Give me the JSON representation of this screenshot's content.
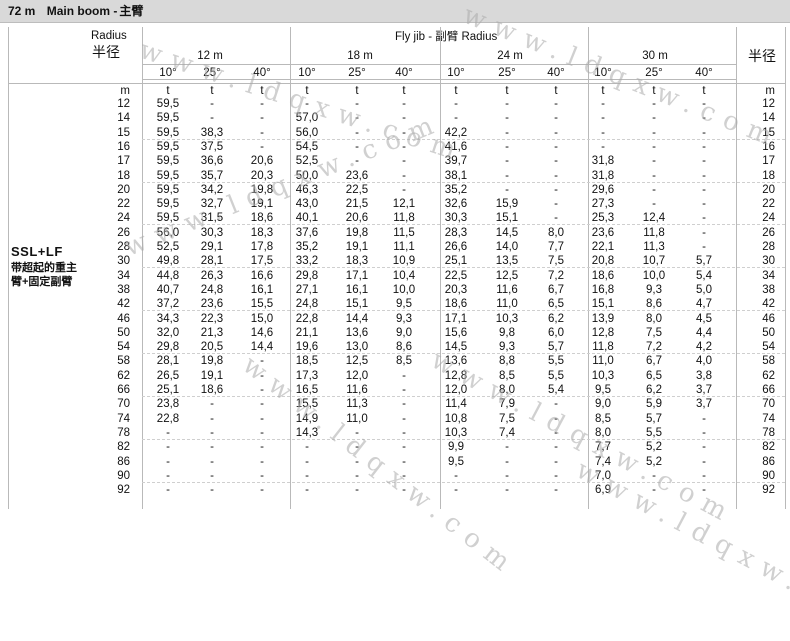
{
  "header": {
    "boom": "72 m",
    "label_en": "Main boom -",
    "label_cn": "主臂"
  },
  "labels": {
    "radius_en": "Radius",
    "radius_cn": "半径",
    "radius_cn_right": "半径",
    "fly_jib": "Fly jib -  副臂 Radius",
    "config_main": "SSL+LF",
    "config_sub": [
      "带超起的重主",
      "臂+固定副臂"
    ]
  },
  "jibs": [
    "12 m",
    "18 m",
    "24 m",
    "30 m"
  ],
  "angles": [
    "10°",
    "25°",
    "40°"
  ],
  "unit_m": "m",
  "unit_t": "t",
  "watermark": "www.ldqxw.com",
  "radii": [
    "12",
    "14",
    "15",
    "16",
    "17",
    "18",
    "20",
    "22",
    "24",
    "26",
    "28",
    "30",
    "34",
    "38",
    "42",
    "46",
    "50",
    "54",
    "58",
    "62",
    "66",
    "70",
    "74",
    "78",
    "82",
    "86",
    "90",
    "92"
  ],
  "rows": [
    [
      "59,5",
      "-",
      "-",
      "-",
      "-",
      "-",
      "-",
      "-",
      "-",
      "-",
      "-",
      "-"
    ],
    [
      "59,5",
      "-",
      "-",
      "57,0",
      "-",
      "-",
      "-",
      "-",
      "-",
      "-",
      "-",
      "-"
    ],
    [
      "59,5",
      "38,3",
      "-",
      "56,0",
      "-",
      "-",
      "42,2",
      "-",
      "-",
      "-",
      "-",
      "-"
    ],
    [
      "59,5",
      "37,5",
      "-",
      "54,5",
      "-",
      "-",
      "41,6",
      "-",
      "-",
      "-",
      "-",
      "-"
    ],
    [
      "59,5",
      "36,6",
      "20,6",
      "52,5",
      "-",
      "-",
      "39,7",
      "-",
      "-",
      "31,8",
      "-",
      "-"
    ],
    [
      "59,5",
      "35,7",
      "20,3",
      "50,0",
      "23,6",
      "-",
      "38,1",
      "-",
      "-",
      "31,8",
      "-",
      "-"
    ],
    [
      "59,5",
      "34,2",
      "19,8",
      "46,3",
      "22,5",
      "-",
      "35,2",
      "-",
      "-",
      "29,6",
      "-",
      "-"
    ],
    [
      "59,5",
      "32,7",
      "19,1",
      "43,0",
      "21,5",
      "12,1",
      "32,6",
      "15,9",
      "-",
      "27,3",
      "-",
      "-"
    ],
    [
      "59,5",
      "31,5",
      "18,6",
      "40,1",
      "20,6",
      "11,8",
      "30,3",
      "15,1",
      "-",
      "25,3",
      "12,4",
      "-"
    ],
    [
      "56,0",
      "30,3",
      "18,3",
      "37,6",
      "19,8",
      "11,5",
      "28,3",
      "14,5",
      "8,0",
      "23,6",
      "11,8",
      "-"
    ],
    [
      "52,5",
      "29,1",
      "17,8",
      "35,2",
      "19,1",
      "11,1",
      "26,6",
      "14,0",
      "7,7",
      "22,1",
      "11,3",
      "-"
    ],
    [
      "49,8",
      "28,1",
      "17,5",
      "33,2",
      "18,3",
      "10,9",
      "25,1",
      "13,5",
      "7,5",
      "20,8",
      "10,7",
      "5,7"
    ],
    [
      "44,8",
      "26,3",
      "16,6",
      "29,8",
      "17,1",
      "10,4",
      "22,5",
      "12,5",
      "7,2",
      "18,6",
      "10,0",
      "5,4"
    ],
    [
      "40,7",
      "24,8",
      "16,1",
      "27,1",
      "16,1",
      "10,0",
      "20,3",
      "11,6",
      "6,7",
      "16,8",
      "9,3",
      "5,0"
    ],
    [
      "37,2",
      "23,6",
      "15,5",
      "24,8",
      "15,1",
      "9,5",
      "18,6",
      "11,0",
      "6,5",
      "15,1",
      "8,6",
      "4,7"
    ],
    [
      "34,3",
      "22,3",
      "15,0",
      "22,8",
      "14,4",
      "9,3",
      "17,1",
      "10,3",
      "6,2",
      "13,9",
      "8,0",
      "4,5"
    ],
    [
      "32,0",
      "21,3",
      "14,6",
      "21,1",
      "13,6",
      "9,0",
      "15,6",
      "9,8",
      "6,0",
      "12,8",
      "7,5",
      "4,4"
    ],
    [
      "29,8",
      "20,5",
      "14,4",
      "19,6",
      "13,0",
      "8,6",
      "14,5",
      "9,3",
      "5,7",
      "11,8",
      "7,2",
      "4,2"
    ],
    [
      "28,1",
      "19,8",
      "-",
      "18,5",
      "12,5",
      "8,5",
      "13,6",
      "8,8",
      "5,5",
      "11,0",
      "6,7",
      "4,0"
    ],
    [
      "26,5",
      "19,1",
      "-",
      "17,3",
      "12,0",
      "-",
      "12,8",
      "8,5",
      "5,5",
      "10,3",
      "6,5",
      "3,8"
    ],
    [
      "25,1",
      "18,6",
      "-",
      "16,5",
      "11,6",
      "-",
      "12,0",
      "8,0",
      "5,4",
      "9,5",
      "6,2",
      "3,7"
    ],
    [
      "23,8",
      "-",
      "-",
      "15,5",
      "11,3",
      "-",
      "11,4",
      "7,9",
      "-",
      "9,0",
      "5,9",
      "3,7"
    ],
    [
      "22,8",
      "-",
      "-",
      "14,9",
      "11,0",
      "-",
      "10,8",
      "7,5",
      "-",
      "8,5",
      "5,7",
      "-"
    ],
    [
      "-",
      "-",
      "-",
      "14,3",
      "-",
      "-",
      "10,3",
      "7,4",
      "-",
      "8,0",
      "5,5",
      "-"
    ],
    [
      "-",
      "-",
      "-",
      "-",
      "-",
      "-",
      "9,9",
      "-",
      "-",
      "7,7",
      "5,2",
      "-"
    ],
    [
      "-",
      "-",
      "-",
      "-",
      "-",
      "-",
      "9,5",
      "-",
      "-",
      "7,4",
      "5,2",
      "-"
    ],
    [
      "-",
      "-",
      "-",
      "-",
      "-",
      "-",
      "-",
      "-",
      "-",
      "7,0",
      "-",
      "-"
    ],
    [
      "-",
      "-",
      "-",
      "-",
      "-",
      "-",
      "-",
      "-",
      "-",
      "6,9",
      "-",
      "-"
    ]
  ]
}
